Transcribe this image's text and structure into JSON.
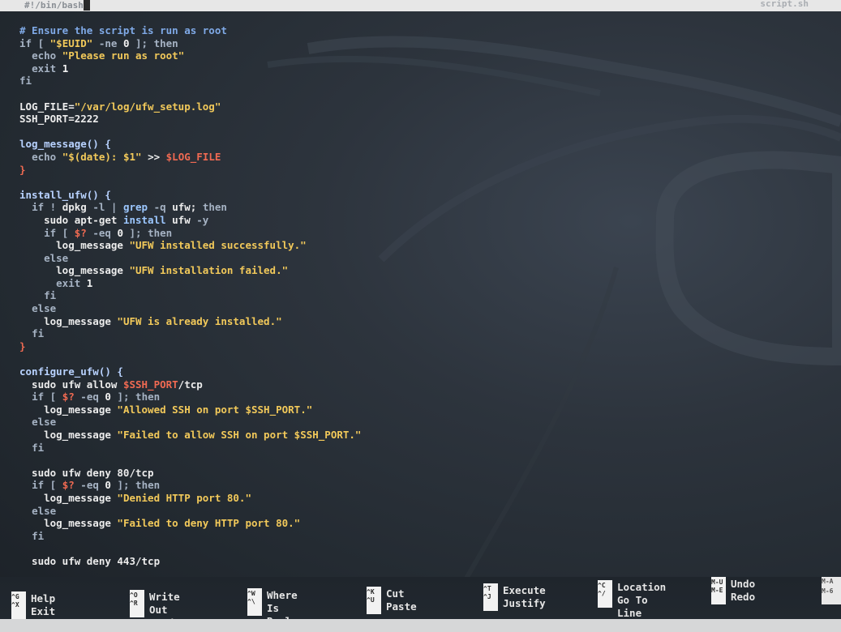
{
  "window": {
    "shebang": "#!/bin/bash",
    "filename": "script.sh"
  },
  "editor_lines": [
    [
      [
        "comment",
        "# Ensure the script is run as root"
      ]
    ],
    [
      [
        "kw",
        "if [ "
      ],
      [
        "str",
        "\"$EUID\""
      ],
      [
        "kw",
        " -ne "
      ],
      [
        "num",
        "0"
      ],
      [
        "kw",
        " ]; then"
      ]
    ],
    [
      [
        "plain",
        "  "
      ],
      [
        "kw",
        "echo "
      ],
      [
        "str",
        "\"Please run as root\""
      ]
    ],
    [
      [
        "plain",
        "  "
      ],
      [
        "kw",
        "exit "
      ],
      [
        "num",
        "1"
      ]
    ],
    [
      [
        "kw",
        "fi"
      ]
    ],
    [
      [
        "plain",
        ""
      ]
    ],
    [
      [
        "plain",
        "LOG_FILE="
      ],
      [
        "str",
        "\"/var/log/ufw_setup.log\""
      ]
    ],
    [
      [
        "plain",
        "SSH_PORT=2222"
      ]
    ],
    [
      [
        "plain",
        ""
      ]
    ],
    [
      [
        "func",
        "log_message() {"
      ]
    ],
    [
      [
        "plain",
        "  "
      ],
      [
        "kw",
        "echo "
      ],
      [
        "str",
        "\"$(date): $1\""
      ],
      [
        "plain",
        " >> "
      ],
      [
        "var",
        "$LOG_FILE"
      ]
    ],
    [
      [
        "brace",
        "}"
      ]
    ],
    [
      [
        "plain",
        ""
      ]
    ],
    [
      [
        "func",
        "install_ufw() {"
      ]
    ],
    [
      [
        "plain",
        "  "
      ],
      [
        "kw",
        "if ! "
      ],
      [
        "plain",
        "dpkg "
      ],
      [
        "kw",
        "-l | "
      ],
      [
        "fn",
        "grep"
      ],
      [
        "kw",
        " -q "
      ],
      [
        "plain",
        "ufw; "
      ],
      [
        "kw",
        "then"
      ]
    ],
    [
      [
        "plain",
        "    sudo apt-get "
      ],
      [
        "fn",
        "install"
      ],
      [
        "plain",
        " ufw "
      ],
      [
        "kw",
        "-y"
      ]
    ],
    [
      [
        "plain",
        "    "
      ],
      [
        "kw",
        "if [ "
      ],
      [
        "var",
        "$?"
      ],
      [
        "kw",
        " -eq "
      ],
      [
        "num",
        "0"
      ],
      [
        "kw",
        " ]; then"
      ]
    ],
    [
      [
        "plain",
        "      log_message "
      ],
      [
        "str",
        "\"UFW installed successfully.\""
      ]
    ],
    [
      [
        "plain",
        "    "
      ],
      [
        "kw",
        "else"
      ]
    ],
    [
      [
        "plain",
        "      log_message "
      ],
      [
        "str",
        "\"UFW installation failed.\""
      ]
    ],
    [
      [
        "plain",
        "      "
      ],
      [
        "kw",
        "exit "
      ],
      [
        "num",
        "1"
      ]
    ],
    [
      [
        "plain",
        "    "
      ],
      [
        "kw",
        "fi"
      ]
    ],
    [
      [
        "plain",
        "  "
      ],
      [
        "kw",
        "else"
      ]
    ],
    [
      [
        "plain",
        "    log_message "
      ],
      [
        "str",
        "\"UFW is already installed.\""
      ]
    ],
    [
      [
        "plain",
        "  "
      ],
      [
        "kw",
        "fi"
      ]
    ],
    [
      [
        "brace",
        "}"
      ]
    ],
    [
      [
        "plain",
        ""
      ]
    ],
    [
      [
        "func",
        "configure_ufw() {"
      ]
    ],
    [
      [
        "plain",
        "  sudo ufw allow "
      ],
      [
        "var",
        "$SSH_PORT"
      ],
      [
        "plain",
        "/tcp"
      ]
    ],
    [
      [
        "plain",
        "  "
      ],
      [
        "kw",
        "if [ "
      ],
      [
        "var",
        "$?"
      ],
      [
        "kw",
        " -eq "
      ],
      [
        "num",
        "0"
      ],
      [
        "kw",
        " ]; then"
      ]
    ],
    [
      [
        "plain",
        "    log_message "
      ],
      [
        "str",
        "\"Allowed SSH on port $SSH_PORT.\""
      ]
    ],
    [
      [
        "plain",
        "  "
      ],
      [
        "kw",
        "else"
      ]
    ],
    [
      [
        "plain",
        "    log_message "
      ],
      [
        "str",
        "\"Failed to allow SSH on port $SSH_PORT.\""
      ]
    ],
    [
      [
        "plain",
        "  "
      ],
      [
        "kw",
        "fi"
      ]
    ],
    [
      [
        "plain",
        ""
      ]
    ],
    [
      [
        "plain",
        "  sudo ufw deny 80/tcp"
      ]
    ],
    [
      [
        "plain",
        "  "
      ],
      [
        "kw",
        "if [ "
      ],
      [
        "var",
        "$?"
      ],
      [
        "kw",
        " -eq "
      ],
      [
        "num",
        "0"
      ],
      [
        "kw",
        " ]; then"
      ]
    ],
    [
      [
        "plain",
        "    log_message "
      ],
      [
        "str",
        "\"Denied HTTP port 80.\""
      ]
    ],
    [
      [
        "plain",
        "  "
      ],
      [
        "kw",
        "else"
      ]
    ],
    [
      [
        "plain",
        "    log_message "
      ],
      [
        "str",
        "\"Failed to deny HTTP port 80.\""
      ]
    ],
    [
      [
        "plain",
        "  "
      ],
      [
        "kw",
        "fi"
      ]
    ],
    [
      [
        "plain",
        ""
      ]
    ],
    [
      [
        "plain",
        "  sudo ufw deny 443/tcp"
      ]
    ]
  ],
  "shortcuts": [
    {
      "key1": "^G",
      "label1": "Help",
      "key2": "^X",
      "label2": "Exit"
    },
    {
      "key1": "^O",
      "label1": "Write Out",
      "key2": "^R",
      "label2": "Read File"
    },
    {
      "key1": "^W",
      "label1": "Where Is",
      "key2": "^\\",
      "label2": "Replace"
    },
    {
      "key1": "^K",
      "label1": "Cut",
      "key2": "^U",
      "label2": "Paste"
    },
    {
      "key1": "^T",
      "label1": "Execute",
      "key2": "^J",
      "label2": "Justify"
    },
    {
      "key1": "^C",
      "label1": "Location",
      "key2": "^/",
      "label2": "Go To Line"
    },
    {
      "key1": "M-U",
      "label1": "Undo",
      "key2": "M-E",
      "label2": "Redo"
    }
  ],
  "edge": {
    "top": "M-A",
    "bottom": "M-6"
  },
  "colors": {
    "comment": "#7fa9e6",
    "keyword": "#a6b3c4",
    "string": "#f2c95a",
    "variable": "#f06a52",
    "function": "#b8d2ff"
  }
}
